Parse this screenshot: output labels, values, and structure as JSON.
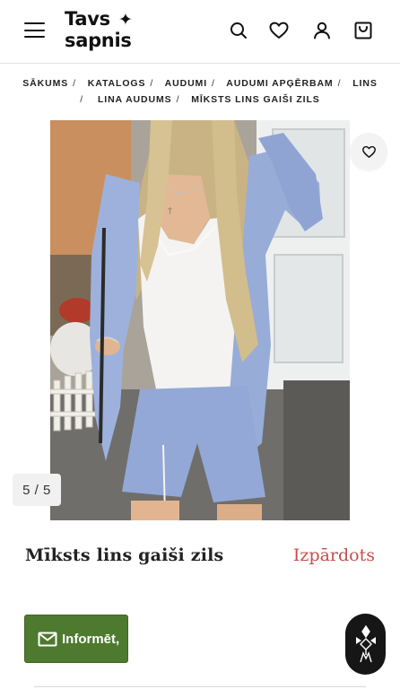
{
  "header": {
    "menu_icon": "hamburger-menu-icon",
    "logo": {
      "line1": "Tavs",
      "line2": "sapnis",
      "star": "✦"
    },
    "icons": [
      "search-icon",
      "heart-icon",
      "user-icon",
      "cart-icon"
    ]
  },
  "breadcrumb": {
    "items": [
      "SĀKUMS",
      "KATALOGS",
      "AUDUMI",
      "AUDUMI APĢĒRBAM",
      "LINS",
      "LINA AUDUMS"
    ],
    "separator": "/",
    "current": "MĪKSTS LINS GAIŠI ZILS"
  },
  "gallery": {
    "counter": "5 / 5",
    "wishlist_icon": "heart-outline-icon"
  },
  "product": {
    "title": "Mīksts lins gaiši zils",
    "status": "Izpārdots"
  },
  "actions": {
    "notify_label": "Informēt,",
    "notify_icon": "envelope-icon",
    "chat_icon": "brand-emblem-icon"
  },
  "colors": {
    "accent_green": "#4d7a2e",
    "sold_out_red": "#c0504d",
    "text": "#222222"
  }
}
